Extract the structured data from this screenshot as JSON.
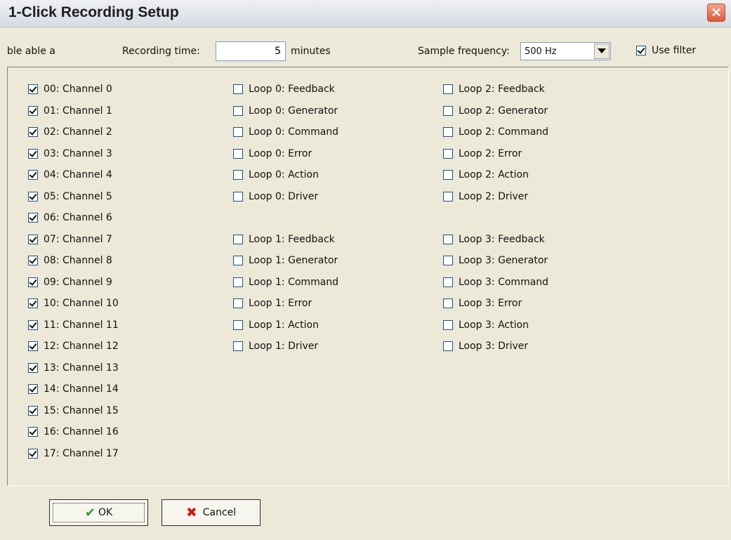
{
  "window": {
    "title": "1-Click Recording Setup",
    "close_label": "✕"
  },
  "toolbar": {
    "fragment": "ble able a",
    "recording_time_label": "Recording time:",
    "recording_time_value": "5",
    "minutes_label": "minutes",
    "sample_frequency_label": "Sample frequency:",
    "sample_frequency_value": "500 Hz",
    "use_filter_label": "Use filter",
    "use_filter_checked": true
  },
  "channels": [
    {
      "label": "00: Channel 0",
      "checked": true
    },
    {
      "label": "01: Channel 1",
      "checked": true
    },
    {
      "label": "02: Channel 2",
      "checked": true
    },
    {
      "label": "03: Channel 3",
      "checked": true
    },
    {
      "label": "04: Channel 4",
      "checked": true
    },
    {
      "label": "05: Channel 5",
      "checked": true
    },
    {
      "label": "06: Channel 6",
      "checked": true
    },
    {
      "label": "07: Channel 7",
      "checked": true
    },
    {
      "label": "08: Channel 8",
      "checked": true
    },
    {
      "label": "09: Channel 9",
      "checked": true
    },
    {
      "label": "10: Channel 10",
      "checked": true
    },
    {
      "label": "11: Channel 11",
      "checked": true
    },
    {
      "label": "12: Channel 12",
      "checked": true
    },
    {
      "label": "13: Channel 13",
      "checked": true
    },
    {
      "label": "14: Channel 14",
      "checked": true
    },
    {
      "label": "15: Channel 15",
      "checked": true
    },
    {
      "label": "16: Channel 16",
      "checked": true
    },
    {
      "label": "17: Channel 17",
      "checked": true
    }
  ],
  "loops_left": [
    {
      "label": "Loop 0: Feedback",
      "checked": false
    },
    {
      "label": "Loop 0: Generator",
      "checked": false
    },
    {
      "label": "Loop 0: Command",
      "checked": false
    },
    {
      "label": "Loop 0: Error",
      "checked": false
    },
    {
      "label": "Loop 0: Action",
      "checked": false
    },
    {
      "label": "Loop 0: Driver",
      "checked": false
    },
    {
      "label": "Loop 1: Feedback",
      "checked": false
    },
    {
      "label": "Loop 1: Generator",
      "checked": false
    },
    {
      "label": "Loop 1: Command",
      "checked": false
    },
    {
      "label": "Loop 1: Error",
      "checked": false
    },
    {
      "label": "Loop 1: Action",
      "checked": false
    },
    {
      "label": "Loop 1: Driver",
      "checked": false
    }
  ],
  "loops_right": [
    {
      "label": "Loop 2: Feedback",
      "checked": false
    },
    {
      "label": "Loop 2: Generator",
      "checked": false
    },
    {
      "label": "Loop 2: Command",
      "checked": false
    },
    {
      "label": "Loop 2: Error",
      "checked": false
    },
    {
      "label": "Loop 2: Action",
      "checked": false
    },
    {
      "label": "Loop 2: Driver",
      "checked": false
    },
    {
      "label": "Loop 3: Feedback",
      "checked": false
    },
    {
      "label": "Loop 3: Generator",
      "checked": false
    },
    {
      "label": "Loop 3: Command",
      "checked": false
    },
    {
      "label": "Loop 3: Error",
      "checked": false
    },
    {
      "label": "Loop 3: Action",
      "checked": false
    },
    {
      "label": "Loop 3: Driver",
      "checked": false
    }
  ],
  "buttons": {
    "ok_label": "OK",
    "ok_icon": "checkmark-icon",
    "cancel_label": "Cancel",
    "cancel_icon": "cross-icon"
  }
}
